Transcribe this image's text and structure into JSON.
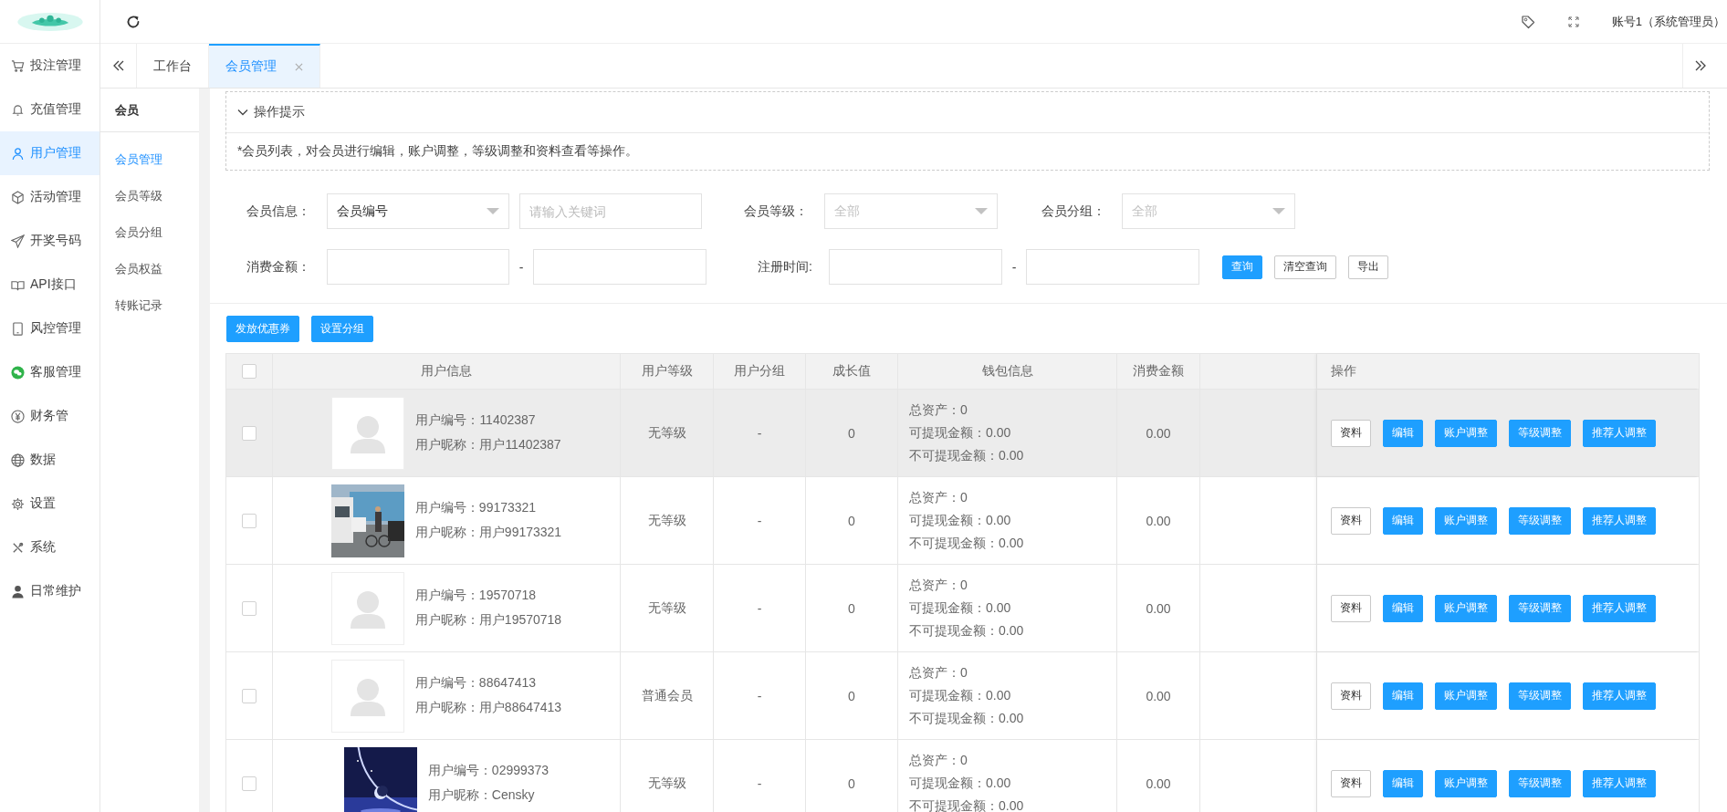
{
  "sidebar": {
    "items": [
      {
        "label": "投注管理",
        "selected": false
      },
      {
        "label": "充值管理",
        "selected": false
      },
      {
        "label": "用户管理",
        "selected": true
      },
      {
        "label": "活动管理",
        "selected": false
      },
      {
        "label": "开奖号码",
        "selected": false
      },
      {
        "label": "API接口",
        "selected": false
      },
      {
        "label": "风控管理",
        "selected": false
      },
      {
        "label": "客服管理",
        "selected": false
      },
      {
        "label": "财务管",
        "selected": false
      },
      {
        "label": "数据",
        "selected": false
      },
      {
        "label": "设置",
        "selected": false
      },
      {
        "label": "系统",
        "selected": false
      },
      {
        "label": "日常维护",
        "selected": false
      }
    ]
  },
  "header": {
    "account": "账号1（系统管理员）"
  },
  "tabs": [
    {
      "label": "工作台",
      "selected": false,
      "closable": false
    },
    {
      "label": "会员管理",
      "selected": true,
      "closable": true
    }
  ],
  "submenu": {
    "title": "会员",
    "items": [
      {
        "label": "会员管理",
        "selected": true
      },
      {
        "label": "会员等级",
        "selected": false
      },
      {
        "label": "会员分组",
        "selected": false
      },
      {
        "label": "会员权益",
        "selected": false
      },
      {
        "label": "转账记录",
        "selected": false
      }
    ]
  },
  "tips": {
    "title": "操作提示",
    "expanded": true,
    "text": "*会员列表，对会员进行编辑，账户调整，等级调整和资料查看等操作。"
  },
  "filters": {
    "member_info": {
      "label": "会员信息：",
      "value": "会员编号",
      "keyword_placeholder": "请输入关键词"
    },
    "member_level": {
      "label": "会员等级：",
      "placeholder": "全部"
    },
    "member_group": {
      "label": "会员分组：",
      "placeholder": "全部"
    },
    "spend": {
      "label": "消费金额：",
      "separator": "-"
    },
    "register_time": {
      "label": "注册时间:",
      "separator": "-"
    },
    "buttons": [
      {
        "label": "查询",
        "kind": "primary"
      },
      {
        "label": "清空查询",
        "kind": "default"
      },
      {
        "label": "导出",
        "kind": "default"
      }
    ]
  },
  "toolbar_buttons": [
    "发放优惠券",
    "设置分组"
  ],
  "table": {
    "select_all_checked": false,
    "columns": [
      "用户信息",
      "用户等级",
      "用户分组",
      "成长值",
      "钱包信息",
      "消费金额",
      "操作"
    ],
    "rows": [
      {
        "checked": false,
        "highlighted": true,
        "avatar": {
          "kind": "placeholder"
        },
        "number": "用户编号：11402387",
        "nickname": "用户昵称：用户11402387",
        "level": "无等级",
        "group": "-",
        "growth": "0",
        "wallet": [
          "总资产：0",
          "可提现金额：0.00",
          "不可提现金额：0.00"
        ],
        "spend": "0.00",
        "actions": [
          {
            "label": "资料",
            "kind": "default"
          },
          {
            "label": "编辑",
            "kind": "primary"
          },
          {
            "label": "账户调整",
            "kind": "primary"
          },
          {
            "label": "等级调整",
            "kind": "primary"
          },
          {
            "label": "推荐人调整",
            "kind": "primary"
          }
        ]
      },
      {
        "checked": false,
        "highlighted": false,
        "number": "用户编号：99173321",
        "nickname": "用户昵称：用户99173321",
        "level": "无等级",
        "group": "-",
        "growth": "0",
        "wallet": [
          "总资产：0",
          "可提现金额：0.00",
          "不可提现金额：0.00"
        ],
        "spend": "0.00",
        "actions": [
          {
            "label": "资料",
            "kind": "default"
          },
          {
            "label": "编辑",
            "kind": "primary"
          },
          {
            "label": "账户调整",
            "kind": "primary"
          },
          {
            "label": "等级调整",
            "kind": "primary"
          },
          {
            "label": "推荐人调整",
            "kind": "primary"
          }
        ]
      },
      {
        "checked": false,
        "highlighted": false,
        "avatar": {
          "kind": "placeholder"
        },
        "number": "用户编号：19570718",
        "nickname": "用户昵称：用户19570718",
        "level": "无等级",
        "group": "-",
        "growth": "0",
        "wallet": [
          "总资产：0",
          "可提现金额：0.00",
          "不可提现金额：0.00"
        ],
        "spend": "0.00",
        "actions": [
          {
            "label": "资料",
            "kind": "default"
          },
          {
            "label": "编辑",
            "kind": "primary"
          },
          {
            "label": "账户调整",
            "kind": "primary"
          },
          {
            "label": "等级调整",
            "kind": "primary"
          },
          {
            "label": "推荐人调整",
            "kind": "primary"
          }
        ]
      },
      {
        "checked": false,
        "highlighted": false,
        "avatar": {
          "kind": "placeholder"
        },
        "number": "用户编号：88647413",
        "nickname": "用户昵称：用户88647413",
        "level": "普通会员",
        "group": "-",
        "growth": "0",
        "wallet": [
          "总资产：0",
          "可提现金额：0.00",
          "不可提现金额：0.00"
        ],
        "spend": "0.00",
        "actions": [
          {
            "label": "资料",
            "kind": "default"
          },
          {
            "label": "编辑",
            "kind": "primary"
          },
          {
            "label": "账户调整",
            "kind": "primary"
          },
          {
            "label": "等级调整",
            "kind": "primary"
          },
          {
            "label": "推荐人调整",
            "kind": "primary"
          }
        ]
      },
      {
        "checked": false,
        "highlighted": false,
        "number": "用户编号：02999373",
        "nickname": "用户昵称：Censky",
        "level": "无等级",
        "group": "-",
        "growth": "0",
        "wallet": [
          "总资产：0",
          "可提现金额：0.00",
          "不可提现金额：0.00"
        ],
        "spend": "0.00",
        "actions": [
          {
            "label": "资料",
            "kind": "default"
          },
          {
            "label": "编辑",
            "kind": "primary"
          },
          {
            "label": "账户调整",
            "kind": "primary"
          },
          {
            "label": "等级调整",
            "kind": "primary"
          },
          {
            "label": "推荐人调整",
            "kind": "primary"
          }
        ]
      }
    ]
  }
}
